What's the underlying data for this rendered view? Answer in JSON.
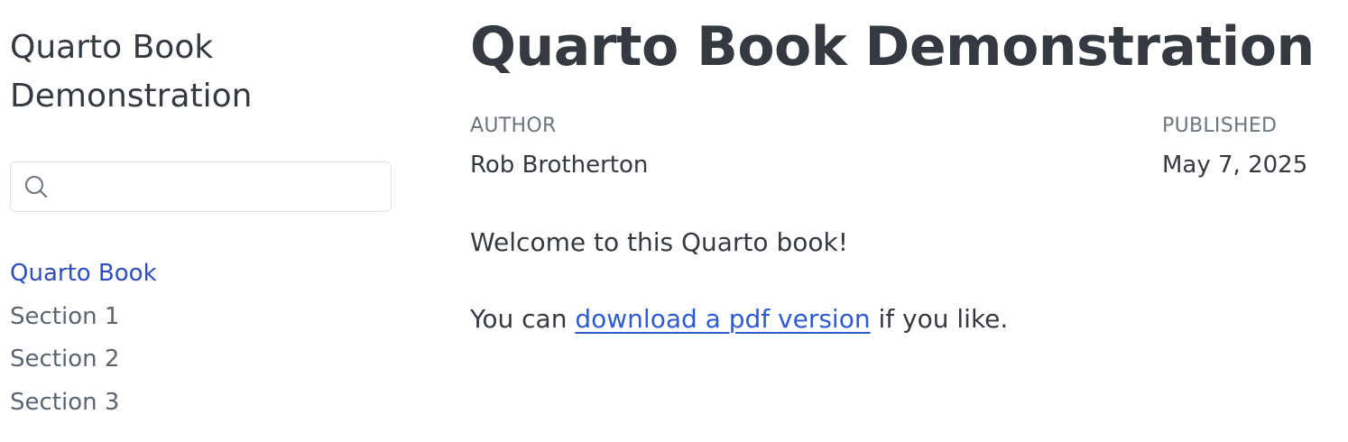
{
  "sidebar": {
    "site_title_line1": "Quarto Book",
    "site_title_line2": "Demonstration",
    "search": {
      "value": "",
      "placeholder": "",
      "icon": "search-icon"
    },
    "items": [
      {
        "label": "Quarto Book",
        "active": true
      },
      {
        "label": "Section 1",
        "active": false
      },
      {
        "label": "Section 2",
        "active": false
      },
      {
        "label": "Section 3",
        "active": false
      }
    ]
  },
  "main": {
    "title": "Quarto Book Demonstration",
    "author_label": "AUTHOR",
    "author": "Rob Brotherton",
    "published_label": "PUBLISHED",
    "published": "May 7, 2025",
    "welcome": "Welcome to this Quarto book!",
    "para2_before": "You can ",
    "para2_link": "download a pdf version",
    "para2_after": " if you like."
  },
  "colors": {
    "text": "#343a40",
    "muted": "#6c757d",
    "active_link": "#2e4ec0",
    "link": "#2e5ad6",
    "border": "#dee2e6"
  }
}
